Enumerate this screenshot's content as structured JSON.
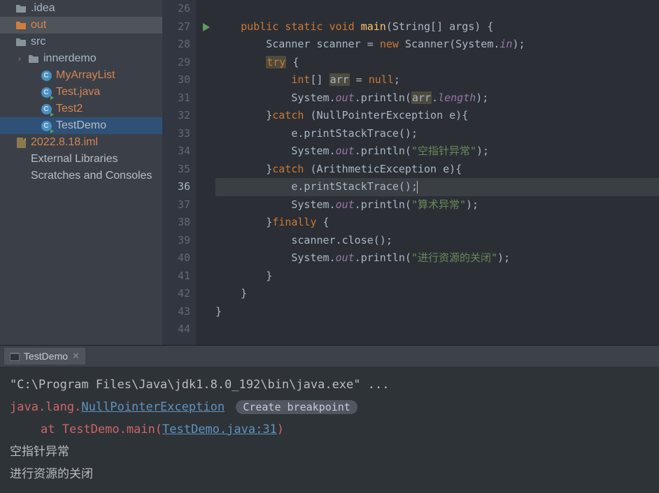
{
  "sidebar": {
    "items": [
      {
        "label": ".idea",
        "icon": "folder",
        "indent": 0,
        "chevron": ""
      },
      {
        "label": "out",
        "icon": "folder-orange",
        "indent": 0,
        "chevron": "",
        "selected": true,
        "textClass": "orange-text"
      },
      {
        "label": "src",
        "icon": "folder",
        "indent": 0,
        "chevron": ""
      },
      {
        "label": "innerdemo",
        "icon": "folder",
        "indent": 1,
        "chevron": "›"
      },
      {
        "label": "MyArrayList",
        "icon": "class",
        "indent": 2,
        "chevron": "",
        "textClass": "orange-text"
      },
      {
        "label": "Test.java",
        "icon": "class-run",
        "indent": 2,
        "chevron": "",
        "textClass": "orange-text"
      },
      {
        "label": "Test2",
        "icon": "class-run",
        "indent": 2,
        "chevron": "",
        "textClass": "orange-text"
      },
      {
        "label": "TestDemo",
        "icon": "class-run",
        "indent": 2,
        "chevron": "",
        "textClass": "gray-text",
        "active": true
      },
      {
        "label": "2022.8.18.iml",
        "icon": "file",
        "indent": 0,
        "chevron": "",
        "textClass": "orange-text"
      },
      {
        "label": "External Libraries",
        "icon": "",
        "indent": 0,
        "chevron": "",
        "textClass": "gray-text"
      },
      {
        "label": "Scratches and Consoles",
        "icon": "",
        "indent": 0,
        "chevron": "",
        "textClass": "gray-text"
      }
    ]
  },
  "editor": {
    "startLine": 26,
    "activeLine": 36,
    "runIconLine": 27,
    "lines": [
      {
        "n": 26,
        "segs": [
          {
            "t": "    "
          }
        ]
      },
      {
        "n": 27,
        "segs": [
          {
            "t": "    "
          },
          {
            "t": "public",
            "c": "kw"
          },
          {
            "t": " "
          },
          {
            "t": "static",
            "c": "kw"
          },
          {
            "t": " "
          },
          {
            "t": "void",
            "c": "kw"
          },
          {
            "t": " "
          },
          {
            "t": "main",
            "c": "method-decl"
          },
          {
            "t": "(String[] args) {"
          }
        ]
      },
      {
        "n": 28,
        "segs": [
          {
            "t": "        Scanner scanner = "
          },
          {
            "t": "new",
            "c": "kw"
          },
          {
            "t": " Scanner(System."
          },
          {
            "t": "in",
            "c": "field"
          },
          {
            "t": ");"
          }
        ]
      },
      {
        "n": 29,
        "segs": [
          {
            "t": "        "
          },
          {
            "t": "try",
            "c": "kw highlight-box"
          },
          {
            "t": " {"
          }
        ]
      },
      {
        "n": 30,
        "segs": [
          {
            "t": "            "
          },
          {
            "t": "int",
            "c": "kw"
          },
          {
            "t": "[] "
          },
          {
            "t": "arr",
            "c": "highlight-box"
          },
          {
            "t": " = "
          },
          {
            "t": "null",
            "c": "kw"
          },
          {
            "t": ";"
          }
        ]
      },
      {
        "n": 31,
        "segs": [
          {
            "t": "            System."
          },
          {
            "t": "out",
            "c": "field"
          },
          {
            "t": ".println("
          },
          {
            "t": "arr",
            "c": "highlight-box"
          },
          {
            "t": "."
          },
          {
            "t": "length",
            "c": "field"
          },
          {
            "t": ");"
          }
        ]
      },
      {
        "n": 32,
        "segs": [
          {
            "t": "        }"
          },
          {
            "t": "catch",
            "c": "kw"
          },
          {
            "t": " (NullPointerException e){"
          }
        ]
      },
      {
        "n": 33,
        "segs": [
          {
            "t": "            e.printStackTrace();"
          }
        ]
      },
      {
        "n": 34,
        "segs": [
          {
            "t": "            System."
          },
          {
            "t": "out",
            "c": "field"
          },
          {
            "t": ".println("
          },
          {
            "t": "\"空指针异常\"",
            "c": "str"
          },
          {
            "t": ");"
          }
        ]
      },
      {
        "n": 35,
        "segs": [
          {
            "t": "        }"
          },
          {
            "t": "catch",
            "c": "kw"
          },
          {
            "t": " (ArithmeticException e){"
          }
        ]
      },
      {
        "n": 36,
        "segs": [
          {
            "t": "            e.printStackTrace();"
          }
        ],
        "caret": true
      },
      {
        "n": 37,
        "segs": [
          {
            "t": "            System."
          },
          {
            "t": "out",
            "c": "field"
          },
          {
            "t": ".println("
          },
          {
            "t": "\"算术异常\"",
            "c": "str"
          },
          {
            "t": ");"
          }
        ]
      },
      {
        "n": 38,
        "segs": [
          {
            "t": "        }"
          },
          {
            "t": "finally",
            "c": "kw"
          },
          {
            "t": " {"
          }
        ]
      },
      {
        "n": 39,
        "segs": [
          {
            "t": "            scanner.close();"
          }
        ]
      },
      {
        "n": 40,
        "segs": [
          {
            "t": "            System."
          },
          {
            "t": "out",
            "c": "field"
          },
          {
            "t": ".println("
          },
          {
            "t": "\"进行资源的关闭\"",
            "c": "str"
          },
          {
            "t": ");"
          }
        ]
      },
      {
        "n": 41,
        "segs": [
          {
            "t": "        }"
          }
        ]
      },
      {
        "n": 42,
        "segs": [
          {
            "t": "    }"
          }
        ]
      },
      {
        "n": 43,
        "segs": [
          {
            "t": "}"
          }
        ]
      },
      {
        "n": 44,
        "segs": [
          {
            "t": ""
          }
        ]
      }
    ]
  },
  "console": {
    "tab": {
      "label": "TestDemo"
    },
    "cmd": "\"C:\\Program Files\\Java\\jdk1.8.0_192\\bin\\java.exe\" ...",
    "err_prefix": "java.lang.",
    "err_exc": "NullPointerException",
    "breakpoint_pill": "Create breakpoint",
    "stack_at": "at ",
    "stack_class": "TestDemo.main",
    "stack_paren_open": "(",
    "stack_link": "TestDemo.java:31",
    "stack_paren_close": ")",
    "stdout1": "空指针异常",
    "stdout2": "进行资源的关闭"
  }
}
